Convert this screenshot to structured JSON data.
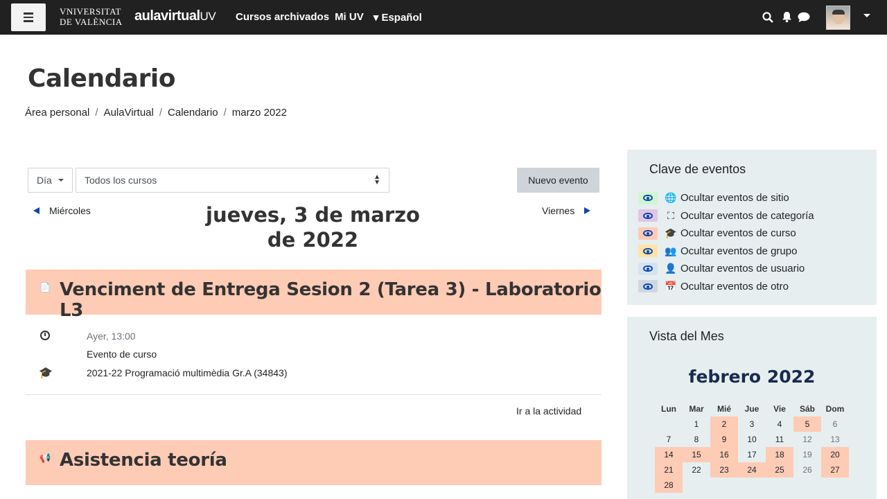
{
  "navbar": {
    "brand_line1": "VNIVERSITAT",
    "brand_line2": "DE VALÈNCIA",
    "aulavirtual_bold": "aulavirtual",
    "aulavirtual_light": "UV",
    "links": [
      "Cursos archivados",
      "Mi UV"
    ],
    "language": "Español",
    "icons": [
      "search-icon",
      "bell-icon",
      "chat-icon"
    ]
  },
  "page": {
    "title": "Calendario",
    "breadcrumb": [
      "Área personal",
      "AulaVirtual",
      "Calendario",
      "marzo 2022"
    ]
  },
  "controls": {
    "view_select": "Día",
    "course_select": "Todos los cursos",
    "new_event_button": "Nuevo evento",
    "prev_day": "Miércoles",
    "next_day": "Viernes",
    "day_heading": "jueves, 3 de marzo de 2022"
  },
  "events": [
    {
      "title": "Venciment de Entrega Sesion 2 (Tarea 3) - Laboratorio L3",
      "time": "Ayer, 13:00",
      "type": "Evento de curso",
      "course": "2021-22 Programació multimèdia Gr.A (34843)",
      "action": "Ir a la actividad"
    },
    {
      "title": "Asistencia teoría"
    }
  ],
  "legend": {
    "title": "Clave de eventos",
    "items": [
      {
        "label": "Ocultar eventos de sitio",
        "color": "#d1f5d1",
        "icon": "globe-icon",
        "glyph": "🌐"
      },
      {
        "label": "Ocultar eventos de categoría",
        "color": "#e1c6e5",
        "icon": "cubes-icon",
        "glyph": "⛶"
      },
      {
        "label": "Ocultar eventos de curso",
        "color": "#fecbb5",
        "icon": "graduation-cap-icon",
        "glyph": "🎓"
      },
      {
        "label": "Ocultar eventos de grupo",
        "color": "#fee3a4",
        "icon": "users-icon",
        "glyph": "👥"
      },
      {
        "label": "Ocultar eventos de usuario",
        "color": "#d6e4f0",
        "icon": "user-icon",
        "glyph": "👤"
      },
      {
        "label": "Ocultar eventos de otro",
        "color": "#cfd8e0",
        "icon": "calendar-icon",
        "glyph": "📅"
      }
    ]
  },
  "month_view": {
    "title": "Vista del Mes",
    "month": "febrero 2022",
    "weekdays": [
      "Lun",
      "Mar",
      "Mié",
      "Jue",
      "Vie",
      "Sáb",
      "Dom"
    ],
    "weeks": [
      [
        "",
        "1",
        "2",
        "3",
        "4",
        "5",
        "6"
      ],
      [
        "7",
        "8",
        "9",
        "10",
        "11",
        "12",
        "13"
      ],
      [
        "14",
        "15",
        "16",
        "17",
        "18",
        "19",
        "20"
      ],
      [
        "21",
        "22",
        "23",
        "24",
        "25",
        "26",
        "27"
      ],
      [
        "28",
        "",
        "",
        "",
        "",
        "",
        ""
      ]
    ],
    "event_days": [
      "2",
      "5",
      "9",
      "14",
      "15",
      "16",
      "18",
      "20",
      "21",
      "23",
      "24",
      "25",
      "27",
      "28"
    ],
    "weekend_days": [
      "6",
      "12",
      "13",
      "19",
      "26"
    ]
  }
}
